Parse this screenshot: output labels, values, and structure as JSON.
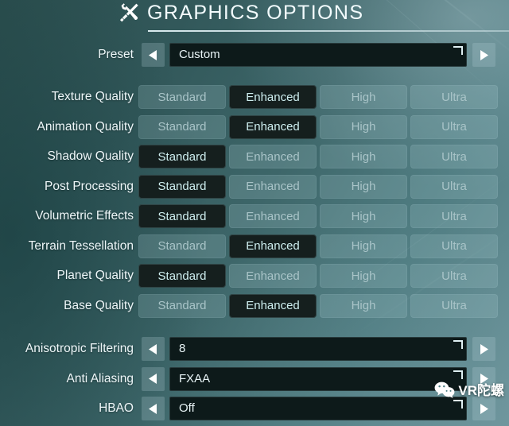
{
  "header": {
    "title": "GRAPHICS OPTIONS",
    "icon": "tools-icon"
  },
  "preset_row": {
    "label": "Preset",
    "value": "Custom",
    "left_arrow": "triangle-left-icon",
    "right_arrow": "triangle-right-icon"
  },
  "quality_options": [
    "Standard",
    "Enhanced",
    "High",
    "Ultra"
  ],
  "quality_rows": [
    {
      "label": "Texture Quality",
      "selected": "Enhanced"
    },
    {
      "label": "Animation Quality",
      "selected": "Enhanced"
    },
    {
      "label": "Shadow Quality",
      "selected": "Standard"
    },
    {
      "label": "Post Processing",
      "selected": "Standard"
    },
    {
      "label": "Volumetric Effects",
      "selected": "Standard"
    },
    {
      "label": "Terrain Tessellation",
      "selected": "Enhanced"
    },
    {
      "label": "Planet Quality",
      "selected": "Standard"
    },
    {
      "label": "Base Quality",
      "selected": "Enhanced"
    }
  ],
  "selector_rows": [
    {
      "label": "Anisotropic Filtering",
      "value": "8"
    },
    {
      "label": "Anti Aliasing",
      "value": "FXAA"
    },
    {
      "label": "HBAO",
      "value": "Off"
    }
  ],
  "watermark": {
    "text": "VR陀螺",
    "icon": "wechat-icon"
  },
  "colors": {
    "selected_bg": "#151f1e",
    "unselected_bg": "rgba(170,205,210,0.22)",
    "text": "#eef7f9",
    "field_bg": "#0d1a1a",
    "accent_rule": "#dff0f3"
  }
}
